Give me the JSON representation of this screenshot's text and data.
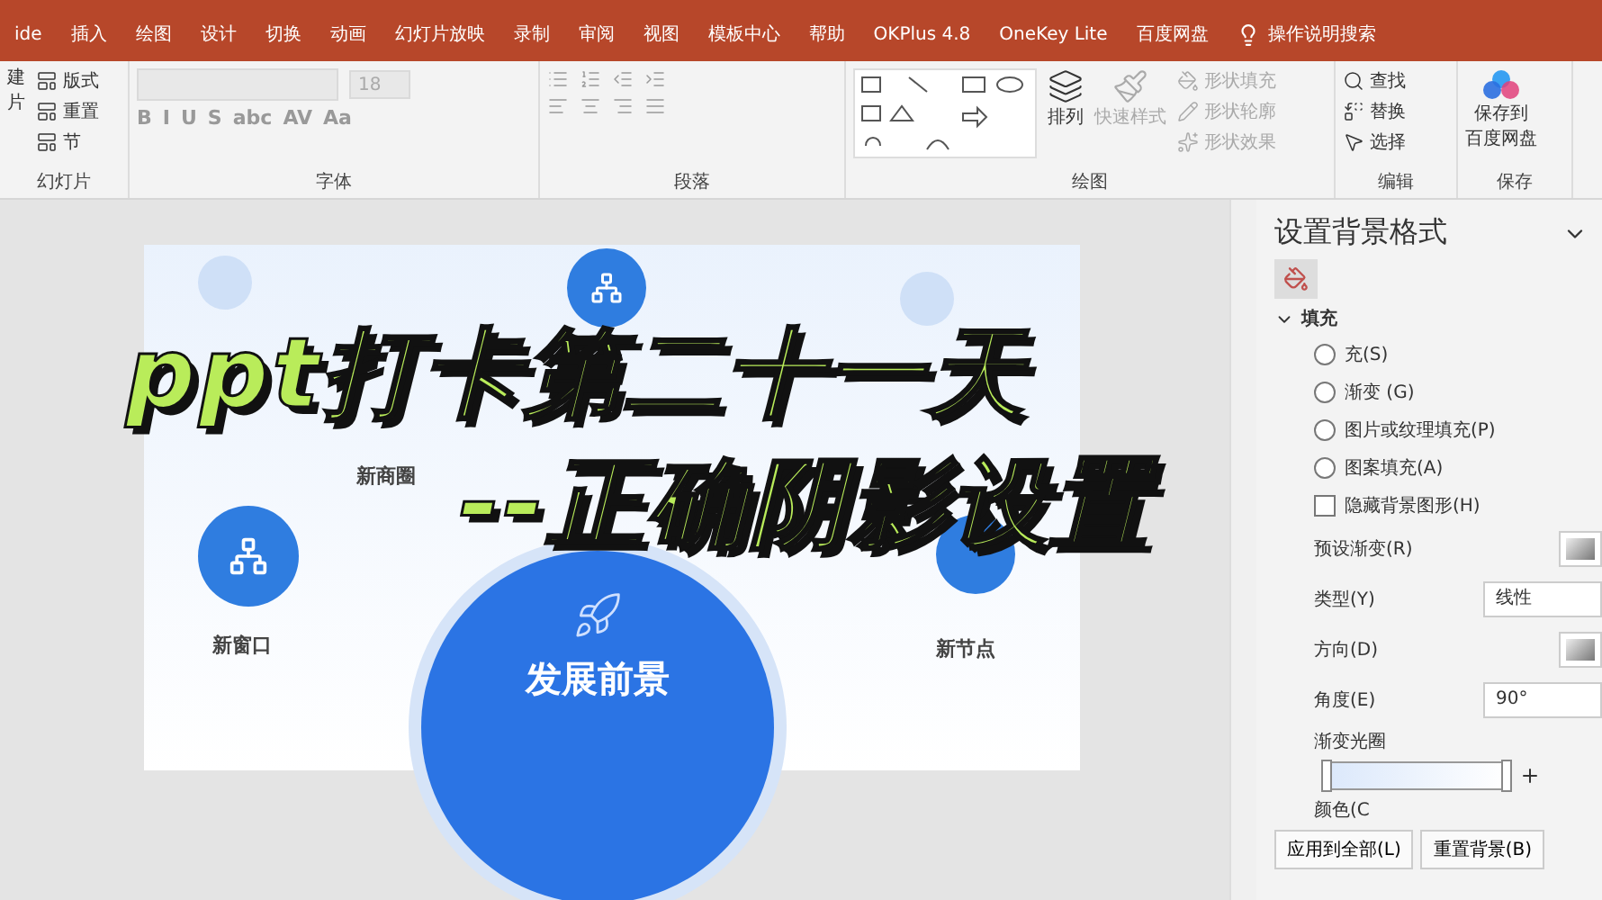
{
  "tabs": [
    {
      "label": "ide"
    },
    {
      "label": "插入"
    },
    {
      "label": "绘图"
    },
    {
      "label": "设计"
    },
    {
      "label": "切换"
    },
    {
      "label": "动画"
    },
    {
      "label": "幻灯片放映"
    },
    {
      "label": "录制"
    },
    {
      "label": "审阅"
    },
    {
      "label": "视图"
    },
    {
      "label": "模板中心"
    },
    {
      "label": "帮助"
    },
    {
      "label": "OKPlus 4.8"
    },
    {
      "label": "OneKey Lite"
    },
    {
      "label": "百度网盘"
    }
  ],
  "search": {
    "placeholder": "操作说明搜索"
  },
  "ribbon": {
    "slides": {
      "new_button": [
        "建",
        "片"
      ],
      "items": [
        "版式",
        "重置",
        "节"
      ],
      "label": "幻灯片"
    },
    "font": {
      "size": "18",
      "format_buttons": [
        "B",
        "I",
        "U",
        "S",
        "abc",
        "AV",
        "Aa"
      ],
      "label": "字体"
    },
    "paragraph": {
      "label": "段落"
    },
    "drawing": {
      "arrange": "排列",
      "quick_styles": {
        "label": "快速样式",
        "disabled": true
      },
      "shape_items": [
        {
          "label": "形状填充",
          "disabled": true
        },
        {
          "label": "形状轮廓",
          "disabled": true
        },
        {
          "label": "形状效果",
          "disabled": true
        }
      ],
      "label": "绘图"
    },
    "editing": {
      "items": [
        "查找",
        "替换",
        "选择"
      ],
      "label": "编辑"
    },
    "save": {
      "button": [
        "保存到",
        "百度网盘"
      ],
      "label": "保存"
    }
  },
  "slide": {
    "nodes": [
      {
        "label": "新商圈"
      },
      {
        "label": "新窗口"
      },
      {
        "label": "新节点"
      }
    ],
    "center": "发展前景"
  },
  "overlay_title": {
    "lines": [
      "ppt打卡第二十一天",
      "--正确阴影设置"
    ]
  },
  "pane": {
    "title": "设置背景格式",
    "section": "填充",
    "section_expanded": true,
    "options": [
      {
        "kind": "radio",
        "label": "充(S)",
        "selected": false
      },
      {
        "kind": "radio",
        "label": "渐变 (G)",
        "selected": false
      },
      {
        "kind": "radio",
        "label": "图片或纹理填充(P)",
        "selected": false
      },
      {
        "kind": "radio",
        "label": "图案填充(A)",
        "selected": false
      },
      {
        "kind": "checkbox",
        "label": "隐藏背景图形(H)",
        "checked": false
      }
    ],
    "fields": [
      {
        "kind": "picker",
        "label": "预设渐变(R)"
      },
      {
        "kind": "select",
        "label": "类型(Y)",
        "value": "线性"
      },
      {
        "kind": "picker",
        "label": "方向(D)"
      },
      {
        "kind": "spin",
        "label": "角度(E)",
        "value": "90°"
      }
    ],
    "stops_label": "渐变光圈",
    "color_label": "颜色(C",
    "buttons": [
      "应用到全部(L)",
      "重置背景(B)"
    ]
  }
}
